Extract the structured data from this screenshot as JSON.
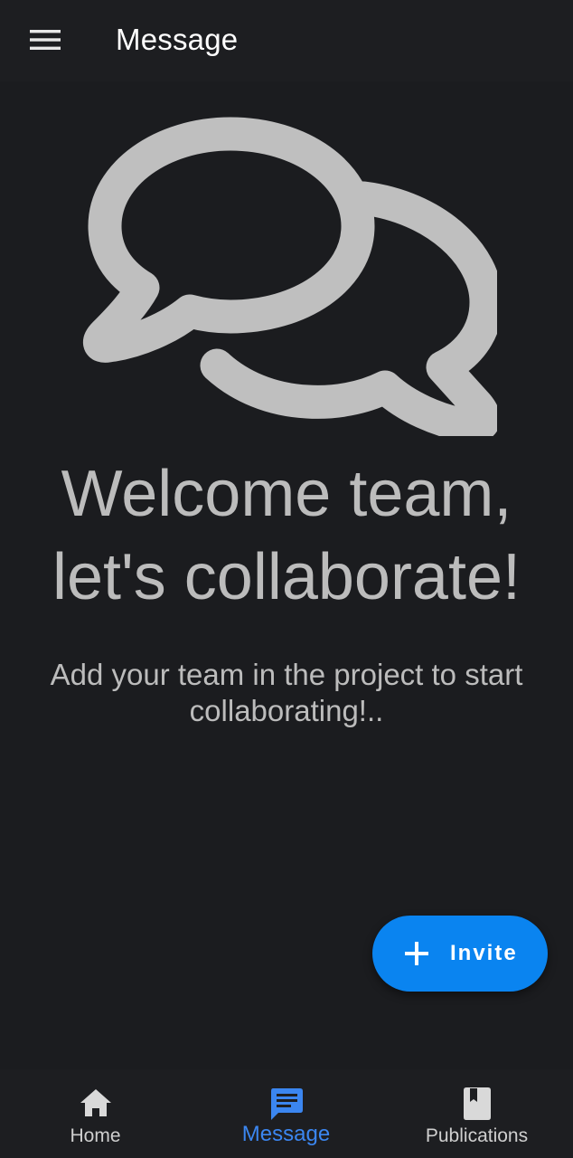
{
  "appbar": {
    "title": "Message",
    "menu_icon": "menu-icon"
  },
  "empty_state": {
    "illustration_icon": "chat-bubbles-icon",
    "headline_line1": "Welcome team,",
    "headline_line2": "let's collaborate!",
    "description": "Add your team in the project to start collaborating!.."
  },
  "fab": {
    "label": "Invite",
    "icon": "plus-icon",
    "color": "#0a84f0"
  },
  "bottom_nav": {
    "items": [
      {
        "label": "Home",
        "icon": "home-icon",
        "active": false
      },
      {
        "label": "Message",
        "icon": "message-icon",
        "active": true
      },
      {
        "label": "Publications",
        "icon": "book-icon",
        "active": false
      }
    ],
    "active_color": "#3b86f0"
  },
  "colors": {
    "background": "#1b1c1f",
    "text_muted": "#bcbcbc"
  }
}
